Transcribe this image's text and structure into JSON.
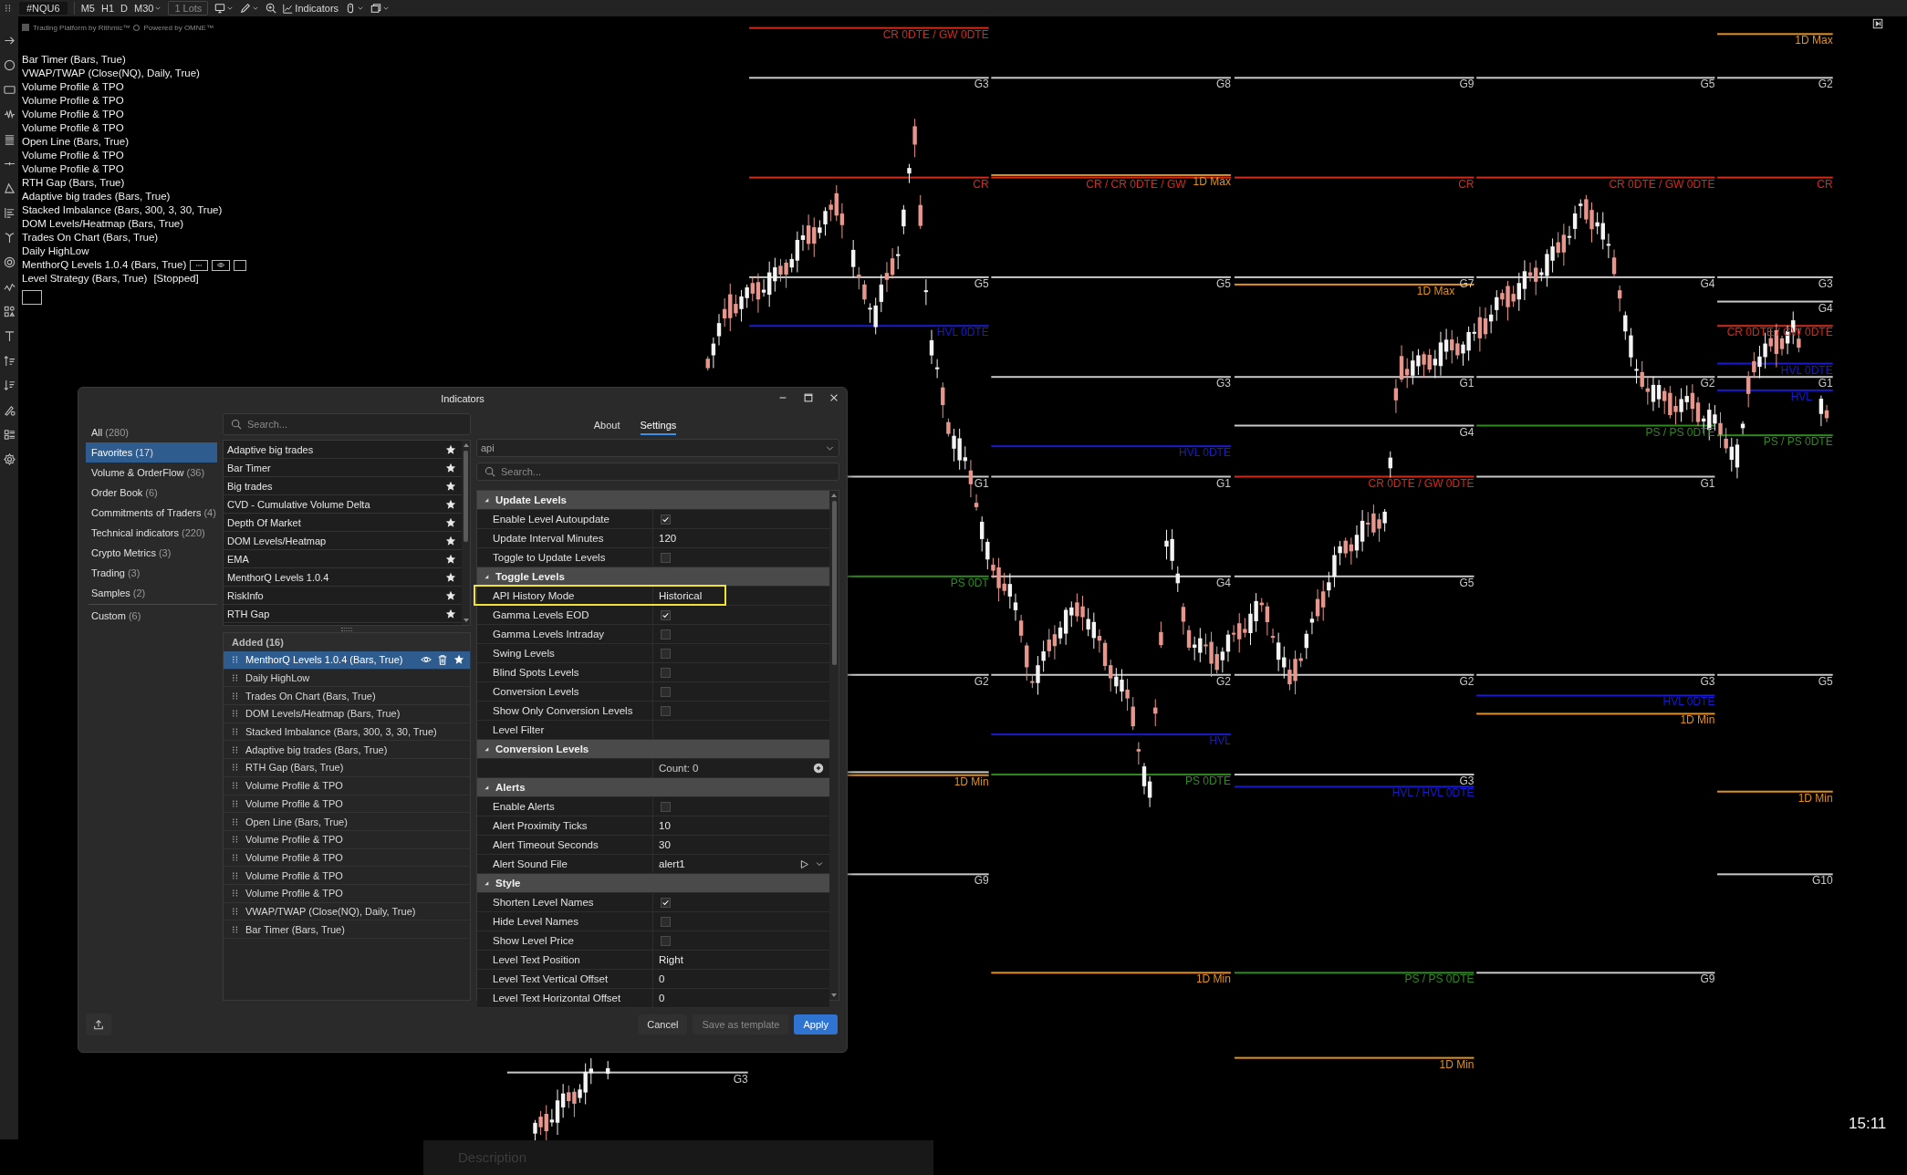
{
  "toolbar": {
    "symbol": "#NQU6",
    "timeframes": [
      "M5",
      "H1",
      "D",
      "M30"
    ],
    "lots": "1 Lots",
    "indicators": "Indicators"
  },
  "branding": [
    "Trading Platform by Rithmic™",
    "Powered by OMNE™"
  ],
  "legend": {
    "items": [
      {
        "label": "Bar Timer (Bars, True)",
        "kind": "plain"
      },
      {
        "label": "VWAP/TWAP (Close(NQ), Daily, True)",
        "kind": "plain"
      },
      {
        "label": "Volume Profile & TPO",
        "kind": "plain"
      },
      {
        "label": "Volume Profile & TPO",
        "kind": "plain"
      },
      {
        "label": "Volume Profile & TPO",
        "kind": "plain"
      },
      {
        "label": "Volume Profile & TPO",
        "kind": "plain"
      },
      {
        "label": "Open Line (Bars, True)",
        "kind": "plain"
      },
      {
        "label": "Volume Profile & TPO",
        "kind": "plain"
      },
      {
        "label": "Volume Profile & TPO",
        "kind": "plain"
      },
      {
        "label": "RTH Gap (Bars, True)",
        "kind": "plain"
      },
      {
        "label": "Adaptive big trades (Bars, True)",
        "kind": "plain"
      },
      {
        "label": "Stacked Imbalance (Bars, 300, 3, 30, True)",
        "kind": "plain"
      },
      {
        "label": "DOM Levels/Heatmap (Bars, True)",
        "kind": "plain"
      },
      {
        "label": "Trades On Chart (Bars, True)",
        "kind": "plain"
      },
      {
        "label": "Daily HighLow",
        "kind": "plain"
      },
      {
        "label": "MenthorQ Levels 1.0.4 (Bars, True)",
        "kind": "controls"
      }
    ],
    "strategy": {
      "label": "Level Strategy (Bars, True)",
      "status": "[Stopped]"
    }
  },
  "chart": {
    "time": "15:11",
    "levels": [
      {
        "label": "CR 0DTE / GW 0DTE",
        "color": "#d42a1c"
      },
      {
        "label": "G3",
        "color": "#c8c8c8"
      },
      {
        "label": "CR",
        "color": "#d42a1c"
      },
      {
        "label": "G5",
        "color": "#c8c8c8"
      },
      {
        "label": "HVL 0DTE",
        "color": "#1a1ad0"
      },
      {
        "label": "G1",
        "color": "#c8c8c8"
      },
      {
        "label": "PS 0DT",
        "color": "#2e8a1e"
      },
      {
        "label": "G2",
        "color": "#c8c8c8"
      },
      {
        "color": "#c8c8c8"
      },
      {
        "label": "1D Min",
        "color": "#e0901e"
      },
      {
        "label": "G9",
        "color": "#c8c8c8"
      },
      {
        "label": "G8",
        "color": "#c8c8c8"
      },
      {
        "label": "CR / CR 0DTE / GW",
        "color": "#d42a1c"
      },
      {
        "label": "1D Max",
        "color": "#e0901e"
      },
      {
        "label": "G5",
        "color": "#c8c8c8"
      },
      {
        "label": "G3",
        "color": "#c8c8c8"
      },
      {
        "label": "HVL 0DTE",
        "color": "#1a1ad0"
      },
      {
        "label": "G1",
        "color": "#c8c8c8"
      },
      {
        "label": "G4",
        "color": "#c8c8c8"
      },
      {
        "label": "G2",
        "color": "#c8c8c8"
      },
      {
        "label": "HVL",
        "color": "#1a1ad0"
      },
      {
        "label": "PS 0DTE",
        "color": "#2e8a1e"
      },
      {
        "label": "1D Min",
        "color": "#e0901e"
      },
      {
        "label": "G9",
        "color": "#c8c8c8"
      },
      {
        "label": "CR",
        "color": "#d42a1c"
      },
      {
        "label": "G7",
        "color": "#c8c8c8"
      },
      {
        "label": "1D Max",
        "color": "#e0901e"
      },
      {
        "label": "G1",
        "color": "#c8c8c8"
      },
      {
        "label": "G4",
        "color": "#c8c8c8"
      },
      {
        "label": "CR 0DTE / GW 0DTE",
        "color": "#d42a1c"
      },
      {
        "label": "G5",
        "color": "#c8c8c8"
      },
      {
        "label": "G2",
        "color": "#c8c8c8"
      },
      {
        "label": "G3",
        "color": "#c8c8c8"
      },
      {
        "label": "HVL / HVL 0DTE",
        "color": "#1a1ad0"
      },
      {
        "label": "PS / PS 0DTE",
        "color": "#2e8a1e"
      },
      {
        "label": "1D Min",
        "color": "#e0901e"
      },
      {
        "label": "G5",
        "color": "#c8c8c8"
      },
      {
        "label": "CR 0DTE / GW 0DTE",
        "color": "#d42a1c"
      },
      {
        "label": "G4",
        "color": "#c8c8c8"
      },
      {
        "label": "G2",
        "color": "#c8c8c8"
      },
      {
        "label": "PS / PS 0DTE",
        "color": "#2e8a1e"
      },
      {
        "label": "G1",
        "color": "#c8c8c8"
      },
      {
        "label": "G3",
        "color": "#c8c8c8"
      },
      {
        "label": "HVL 0DTE",
        "color": "#1a1ad0"
      },
      {
        "label": "1D Min",
        "color": "#e0901e"
      },
      {
        "label": "G9",
        "color": "#c8c8c8"
      },
      {
        "label": "1D Max",
        "color": "#e0901e"
      },
      {
        "label": "G2",
        "color": "#c8c8c8"
      },
      {
        "label": "CR",
        "color": "#d42a1c"
      },
      {
        "label": "G3",
        "color": "#c8c8c8"
      },
      {
        "label": "G4",
        "color": "#c8c8c8"
      },
      {
        "label": "CR 0DTE / GW 0DTE",
        "color": "#d42a1c"
      },
      {
        "label": "HVL 0DTE",
        "color": "#1a1ad0"
      },
      {
        "label": "G1",
        "color": "#c8c8c8"
      },
      {
        "label": "HVL",
        "color": "#1a1ad0"
      },
      {
        "label": "PS / PS 0DTE",
        "color": "#2e8a1e"
      },
      {
        "label": "G5",
        "color": "#c8c8c8"
      },
      {
        "label": "1D Min",
        "color": "#e0901e"
      },
      {
        "label": "G10",
        "color": "#c8c8c8"
      },
      {
        "label": "G3",
        "color": "#c8c8c8"
      }
    ]
  },
  "description_bar": "Description",
  "dialog": {
    "title": "Indicators",
    "categories": [
      {
        "label": "All",
        "count": "(280)",
        "selected": false
      },
      {
        "label": "Favorites",
        "count": "(17)",
        "selected": true
      },
      {
        "label": "Volume & OrderFlow",
        "count": "(36)",
        "selected": false
      },
      {
        "label": "Order Book",
        "count": "(6)",
        "selected": false
      },
      {
        "label": "Commitments of Traders",
        "count": "(4)",
        "selected": false
      },
      {
        "label": "Technical indicators",
        "count": "(220)",
        "selected": false
      },
      {
        "label": "Crypto Metrics",
        "count": "(3)",
        "selected": false
      },
      {
        "label": "Trading",
        "count": "(3)",
        "selected": false
      },
      {
        "label": "Samples",
        "count": "(2)",
        "selected": false
      },
      {
        "label": "Custom",
        "count": "(6)",
        "selected": false
      }
    ],
    "search": {
      "placeholder": "Search..."
    },
    "favorites": [
      "Adaptive big trades",
      "Bar Timer",
      "Big trades",
      "CVD - Cumulative Volume Delta",
      "Depth Of Market",
      "DOM Levels/Heatmap",
      "EMA",
      "MenthorQ Levels 1.0.4",
      "RiskInfo",
      "RTH Gap"
    ],
    "added": {
      "title": "Added (16)",
      "items": [
        {
          "label": "MenthorQ Levels 1.0.4 (Bars, True)",
          "selected": true
        },
        {
          "label": "Daily HighLow",
          "selected": false
        },
        {
          "label": "Trades On Chart (Bars, True)",
          "selected": false
        },
        {
          "label": "DOM Levels/Heatmap (Bars, True)",
          "selected": false
        },
        {
          "label": "Stacked Imbalance (Bars, 300, 3, 30, True)",
          "selected": false
        },
        {
          "label": "Adaptive big trades (Bars, True)",
          "selected": false
        },
        {
          "label": "RTH Gap (Bars, True)",
          "selected": false
        },
        {
          "label": "Volume Profile & TPO",
          "selected": false
        },
        {
          "label": "Volume Profile & TPO",
          "selected": false
        },
        {
          "label": "Open Line (Bars, True)",
          "selected": false
        },
        {
          "label": "Volume Profile & TPO",
          "selected": false
        },
        {
          "label": "Volume Profile & TPO",
          "selected": false
        },
        {
          "label": "Volume Profile & TPO",
          "selected": false
        },
        {
          "label": "Volume Profile & TPO",
          "selected": false
        },
        {
          "label": "VWAP/TWAP (Close(NQ), Daily, True)",
          "selected": false
        },
        {
          "label": "Bar Timer (Bars, True)",
          "selected": false
        }
      ]
    },
    "tabs": [
      {
        "label": "About",
        "selected": false
      },
      {
        "label": "Settings",
        "selected": true
      }
    ],
    "preset": {
      "value": "api"
    },
    "settings_search": {
      "placeholder": "Search..."
    },
    "sections": [
      {
        "title": "Update Levels",
        "expanded": true,
        "rows": [
          {
            "label": "Enable Level Autoupdate",
            "kind": "check",
            "checked": true,
            "highlighted": false
          },
          {
            "label": "Update Interval Minutes",
            "kind": "text",
            "value": "120",
            "highlighted": false
          },
          {
            "label": "Toggle to Update Levels",
            "kind": "check",
            "checked": false,
            "highlighted": false
          }
        ]
      },
      {
        "title": "Toggle Levels",
        "expanded": true,
        "rows": [
          {
            "label": "API History Mode",
            "kind": "text",
            "value": "Historical",
            "highlighted": true
          },
          {
            "label": "Gamma Levels EOD",
            "kind": "check",
            "checked": true,
            "highlighted": false
          },
          {
            "label": "Gamma Levels Intraday",
            "kind": "check",
            "checked": false,
            "highlighted": false
          },
          {
            "label": "Swing Levels",
            "kind": "check",
            "checked": false,
            "highlighted": false
          },
          {
            "label": "Blind Spots Levels",
            "kind": "check",
            "checked": false,
            "highlighted": false
          },
          {
            "label": "Conversion Levels",
            "kind": "check",
            "checked": false,
            "highlighted": false
          },
          {
            "label": "Show Only Conversion Levels",
            "kind": "check",
            "checked": false,
            "highlighted": false
          },
          {
            "label": "Level Filter",
            "kind": "text",
            "highlighted": false
          }
        ]
      },
      {
        "title": "Conversion Levels",
        "expanded": true,
        "rows": [
          {
            "kind": "count",
            "value": "Count: 0",
            "highlighted": false
          }
        ]
      },
      {
        "title": "Alerts",
        "expanded": true,
        "rows": [
          {
            "label": "Enable Alerts",
            "kind": "check",
            "checked": false,
            "highlighted": false
          },
          {
            "label": "Alert Proximity Ticks",
            "kind": "text",
            "value": "10",
            "highlighted": false
          },
          {
            "label": "Alert Timeout Seconds",
            "kind": "text",
            "value": "30",
            "highlighted": false
          },
          {
            "label": "Alert Sound File",
            "kind": "sound",
            "value": "alert1",
            "highlighted": false
          }
        ]
      },
      {
        "title": "Style",
        "expanded": true,
        "rows": [
          {
            "label": "Shorten Level Names",
            "kind": "check",
            "checked": true,
            "highlighted": false
          },
          {
            "label": "Hide Level Names",
            "kind": "check",
            "checked": false,
            "highlighted": false
          },
          {
            "label": "Show Level Price",
            "kind": "check",
            "checked": false,
            "highlighted": false
          },
          {
            "label": "Level Text Position",
            "kind": "text",
            "value": "Right",
            "highlighted": false
          },
          {
            "label": "Level Text Vertical Offset",
            "kind": "text",
            "value": "0",
            "highlighted": false
          },
          {
            "label": "Level Text Horizontal Offset",
            "kind": "text",
            "value": "0",
            "highlighted": false
          }
        ]
      }
    ],
    "buttons": [
      {
        "label": "Cancel",
        "kind": "plain"
      },
      {
        "label": "Save as template",
        "kind": "muted"
      },
      {
        "label": "Apply",
        "kind": "primary"
      }
    ]
  }
}
